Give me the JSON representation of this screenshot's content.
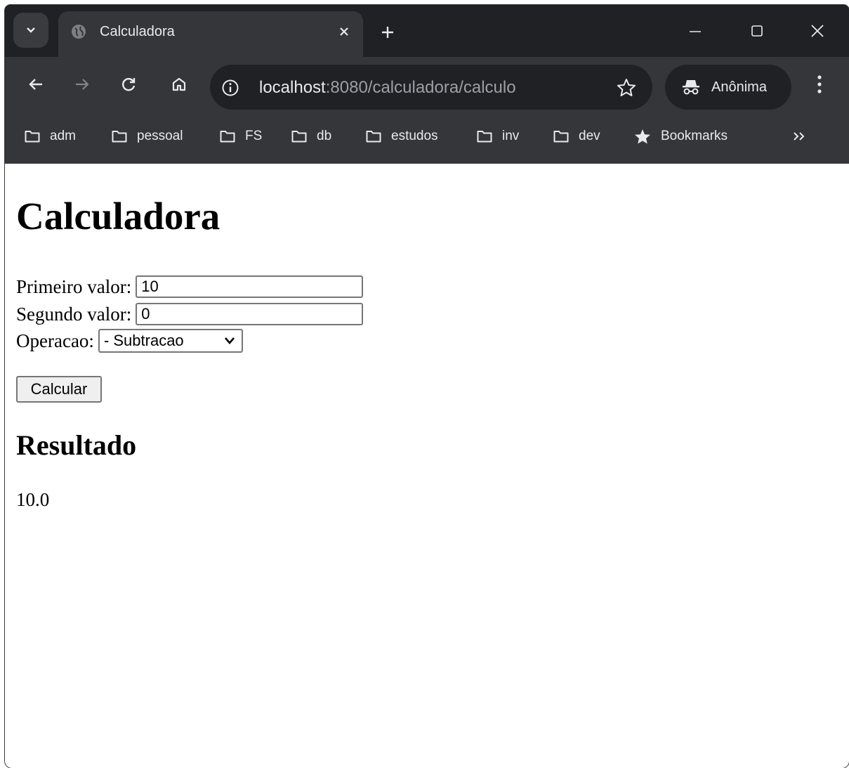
{
  "browser": {
    "tab": {
      "title": "Calculadora"
    },
    "address": {
      "host": "localhost",
      "path": ":8080/calculadora/calculo"
    },
    "profile_label": "Anônima",
    "bookmarks": [
      {
        "label": "adm",
        "icon": "folder-icon"
      },
      {
        "label": "pessoal",
        "icon": "folder-icon"
      },
      {
        "label": "FS",
        "icon": "folder-icon"
      },
      {
        "label": "db",
        "icon": "folder-icon"
      },
      {
        "label": "estudos",
        "icon": "folder-icon"
      },
      {
        "label": "inv",
        "icon": "folder-icon"
      },
      {
        "label": "dev",
        "icon": "folder-icon"
      },
      {
        "label": "Bookmarks",
        "icon": "star-icon"
      }
    ],
    "colors": {
      "frame": "#202124",
      "toolbar": "#35363a",
      "text": "#e8eaed"
    }
  },
  "page": {
    "title": "Calculadora",
    "form": {
      "first_label": "Primeiro valor:",
      "first_value": "10",
      "second_label": "Segundo valor:",
      "second_value": "0",
      "operation_label": "Operacao:",
      "operation_selected": "- Subtracao",
      "submit_label": "Calcular"
    },
    "result_heading": "Resultado",
    "result_value": "10.0"
  }
}
